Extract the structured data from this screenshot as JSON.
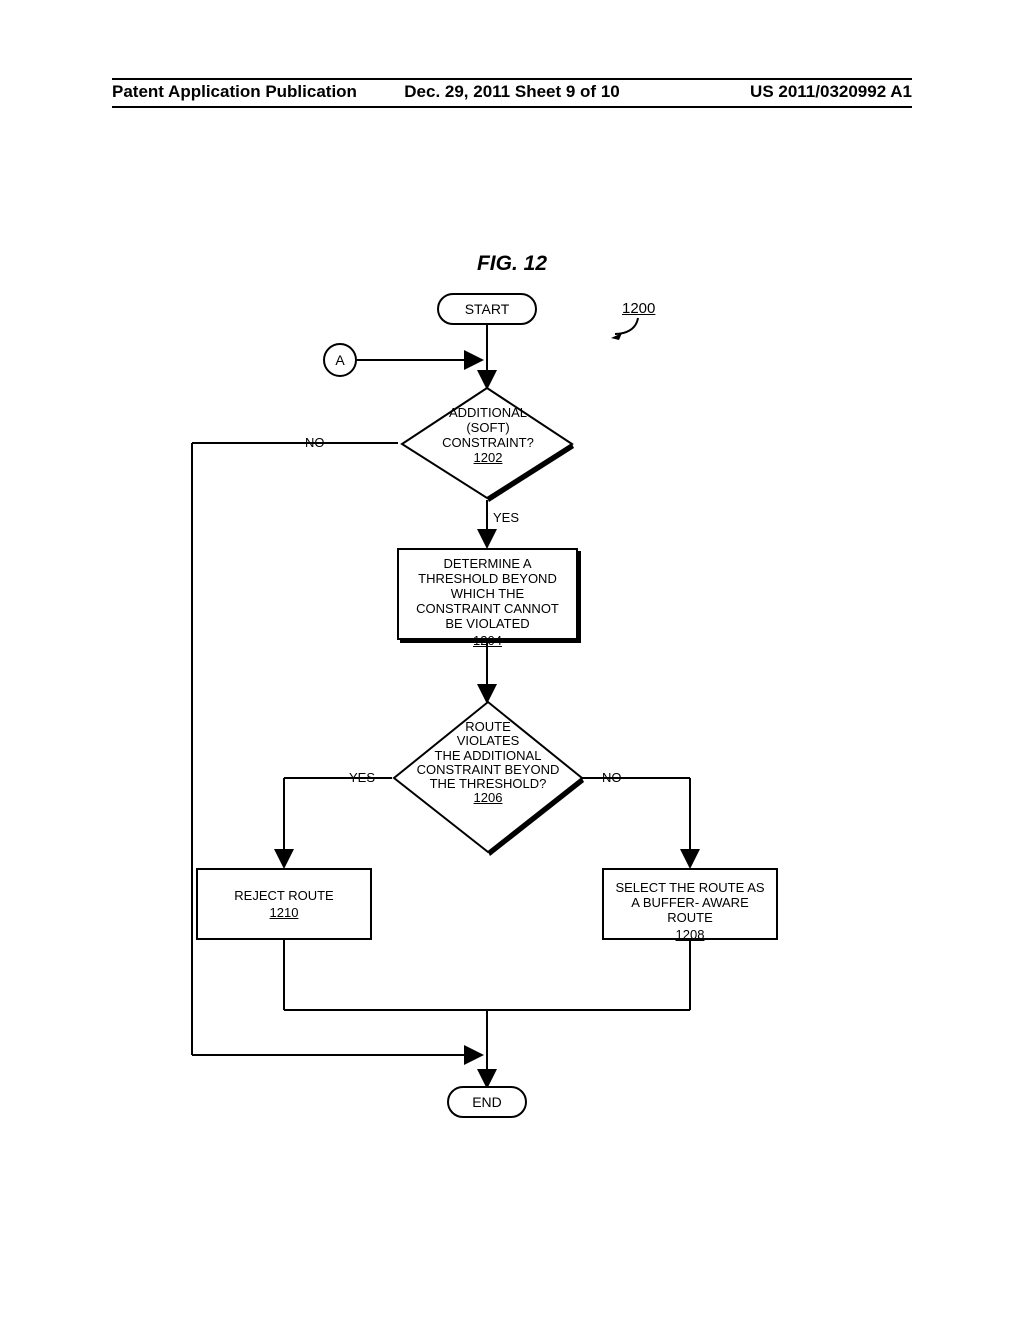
{
  "header": {
    "left": "Patent Application Publication",
    "middle": "Dec. 29, 2011   Sheet 9 of 10",
    "right": "US 2011/0320992 A1"
  },
  "figure_title": "FIG. 12",
  "figure_ref": "1200",
  "nodes": {
    "start": "START",
    "connector_a": "A",
    "decision1": {
      "text": "ADDITIONAL\n(SOFT)\nCONSTRAINT?",
      "ref": "1202"
    },
    "process_threshold": {
      "text": "DETERMINE A THRESHOLD BEYOND WHICH THE CONSTRAINT CANNOT BE VIOLATED",
      "ref": "1204"
    },
    "decision2": {
      "text": "ROUTE\nVIOLATES\nTHE ADDITIONAL\nCONSTRAINT BEYOND\nTHE THRESHOLD?",
      "ref": "1206"
    },
    "process_select": {
      "text": "SELECT THE ROUTE AS A BUFFER- AWARE ROUTE",
      "ref": "1208"
    },
    "process_reject": {
      "text": "REJECT ROUTE",
      "ref": "1210"
    },
    "end": "END"
  },
  "edge_labels": {
    "no1": "NO",
    "yes1": "YES",
    "yes2": "YES",
    "no2": "NO"
  },
  "chart_data": {
    "type": "flowchart",
    "nodes": [
      {
        "id": "start",
        "kind": "terminator",
        "label": "START"
      },
      {
        "id": "A",
        "kind": "connector",
        "label": "A"
      },
      {
        "id": "d1",
        "kind": "decision",
        "label": "ADDITIONAL (SOFT) CONSTRAINT?",
        "ref": "1202"
      },
      {
        "id": "p1",
        "kind": "process",
        "label": "DETERMINE A THRESHOLD BEYOND WHICH THE CONSTRAINT CANNOT BE VIOLATED",
        "ref": "1204"
      },
      {
        "id": "d2",
        "kind": "decision",
        "label": "ROUTE VIOLATES THE ADDITIONAL CONSTRAINT BEYOND THE THRESHOLD?",
        "ref": "1206"
      },
      {
        "id": "p_reject",
        "kind": "process",
        "label": "REJECT ROUTE",
        "ref": "1210"
      },
      {
        "id": "p_select",
        "kind": "process",
        "label": "SELECT THE ROUTE AS A BUFFER- AWARE ROUTE",
        "ref": "1208"
      },
      {
        "id": "end",
        "kind": "terminator",
        "label": "END"
      }
    ],
    "edges": [
      {
        "from": "start",
        "to": "d1"
      },
      {
        "from": "A",
        "to": "d1"
      },
      {
        "from": "d1",
        "to": "p1",
        "label": "YES"
      },
      {
        "from": "d1",
        "to": "end",
        "label": "NO"
      },
      {
        "from": "p1",
        "to": "d2"
      },
      {
        "from": "d2",
        "to": "p_reject",
        "label": "YES"
      },
      {
        "from": "d2",
        "to": "p_select",
        "label": "NO"
      },
      {
        "from": "p_reject",
        "to": "end"
      },
      {
        "from": "p_select",
        "to": "end"
      }
    ],
    "figure_ref": "1200"
  }
}
